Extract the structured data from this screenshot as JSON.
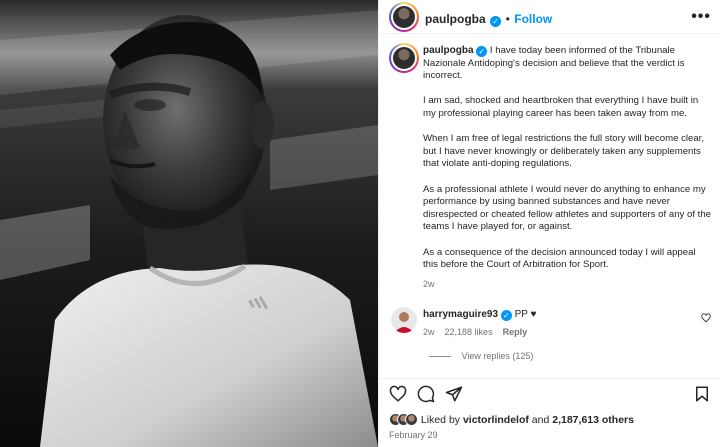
{
  "post": {
    "username": "paulpogba",
    "verified_mark": "✓",
    "separator": "•",
    "follow_label": "Follow",
    "more_label": "•••"
  },
  "caption": {
    "username": "paulpogba",
    "paragraphs": [
      "I have today been informed of the Tribunale Nazionale Antidoping's decision and believe that the verdict is incorrect.",
      "I am sad, shocked and heartbroken that everything I have built in my professional playing career has been taken away from me.",
      "When I am free of legal restrictions the full story will become clear, but I have never knowingly or deliberately taken any supplements that violate anti-doping regulations.",
      "As a professional athlete I would never do anything to enhance my performance by using banned substances and have never disrespected or cheated fellow athletes and supporters of any of the teams I have played for, or against.",
      "As a consequence of the decision announced today I will appeal this before the Court of Arbitration for Sport."
    ],
    "age": "2w"
  },
  "comment": {
    "username": "harrymaguire93",
    "text": "PP ♥",
    "age": "2w",
    "likes": "22,188 likes",
    "reply_label": "Reply",
    "view_replies": "View replies (125)"
  },
  "footer": {
    "liked_by_prefix": "Liked by ",
    "liked_by_user": "victorlindelof",
    "liked_by_and": " and ",
    "liked_by_count": "2,187,613 others",
    "date": "February 29"
  },
  "icons": [
    "heart-icon",
    "comment-icon",
    "share-icon",
    "bookmark-icon",
    "more-icon",
    "verified-icon"
  ]
}
